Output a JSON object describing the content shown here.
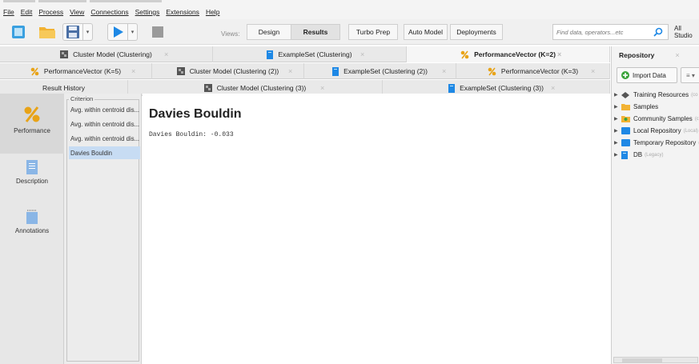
{
  "menu": [
    "File",
    "Edit",
    "Process",
    "View",
    "Connections",
    "Settings",
    "Extensions",
    "Help"
  ],
  "toolbar": {
    "views_label": "Views:",
    "views": [
      "Design",
      "Results",
      "Turbo Prep",
      "Auto Model",
      "Deployments"
    ],
    "active_view": "Results",
    "search_placeholder": "Find data, operators...etc",
    "scope": "All Studio"
  },
  "tabs": {
    "row1": [
      "Cluster Model (Clustering)",
      "ExampleSet (Clustering)",
      "PerformanceVector (K=2)"
    ],
    "row2": [
      "PerformanceVector (K=5)",
      "Cluster Model (Clustering (2))",
      "ExampleSet (Clustering (2))",
      "PerformanceVector (K=3)"
    ],
    "row3": [
      "Result History",
      "Cluster Model (Clustering (3))",
      "ExampleSet (Clustering (3))"
    ],
    "close_glyph": "×"
  },
  "sidebar": [
    "Performance",
    "Description",
    "Annotations"
  ],
  "criterion": {
    "title": "Criterion",
    "items": [
      "Avg. within centroid dis...",
      "Avg. within centroid dis...",
      "Avg. within centroid dis...",
      "Davies Bouldin"
    ],
    "selected": "Davies Bouldin"
  },
  "content": {
    "title": "Davies Bouldin",
    "text": "Davies Bouldin: -0.033"
  },
  "repository": {
    "tab": "Repository",
    "import_button": "Import Data",
    "menu_button": "≡ ▾",
    "items": [
      {
        "label": "Training Resources",
        "hint": "(co"
      },
      {
        "label": "Samples",
        "hint": ""
      },
      {
        "label": "Community Samples",
        "hint": "(c"
      },
      {
        "label": "Local Repository",
        "hint": "(Local)"
      },
      {
        "label": "Temporary Repository",
        "hint": "("
      },
      {
        "label": "DB",
        "hint": "(Legacy)"
      }
    ]
  },
  "colors": {
    "accent_blue": "#1e88e5",
    "selection": "#c7dcf3",
    "performance_icon": "#e8a317"
  }
}
